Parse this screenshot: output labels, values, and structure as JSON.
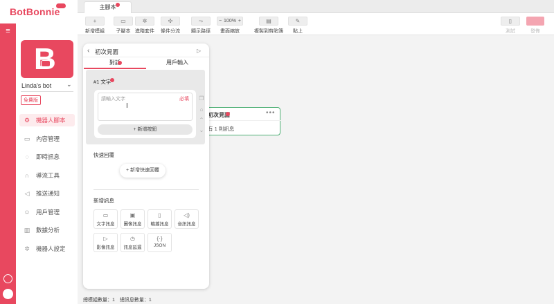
{
  "brand": {
    "name": "BotBonnie",
    "color": "#e8485f"
  },
  "bot": {
    "name": "Linda's bot",
    "plan": "免費版",
    "logo_letter": "B"
  },
  "sidebar": {
    "items": [
      {
        "label": "機器人腳本",
        "icon": "robot-script-icon",
        "active": true
      },
      {
        "label": "內容管理",
        "icon": "folder-icon"
      },
      {
        "label": "即時訊息",
        "icon": "chat-icon"
      },
      {
        "label": "導流工具",
        "icon": "magnet-icon"
      },
      {
        "label": "推送通知",
        "icon": "megaphone-icon"
      },
      {
        "label": "用戶管理",
        "icon": "users-icon"
      },
      {
        "label": "數據分析",
        "icon": "chart-icon"
      },
      {
        "label": "機器人設定",
        "icon": "gear-icon"
      }
    ]
  },
  "tabs": {
    "main": "主腳本"
  },
  "toolbar": {
    "new_module": "新增模組",
    "sub_script": "子腳本",
    "advanced": "進階套件",
    "condition": "條件分流",
    "show_path": "顯示路徑",
    "zoom_value": "100%",
    "zoom_minus": "−",
    "zoom_plus": "+",
    "zoom_label": "畫面縮放",
    "copy": "複製到剪貼簿",
    "paste": "貼上",
    "test": "測試",
    "publish": "發佈"
  },
  "node": {
    "title": "初次見面",
    "subtitle": "有 1 則訊息"
  },
  "panel": {
    "title": "初次見面",
    "tab_dialog": "對話",
    "tab_user_input": "用戶輸入",
    "text_label": "#1 文字",
    "placeholder": "請輸入文字",
    "required": "必填",
    "add_button": "+ 新增按鈕",
    "quick_reply_label": "快速回覆",
    "add_quick_reply": "+ 新增快速回覆",
    "new_message_label": "新增訊息",
    "message_types": [
      {
        "label": "文字訊息",
        "icon": "text-message-icon",
        "glyph": "▭"
      },
      {
        "label": "圖像訊息",
        "icon": "image-message-icon",
        "glyph": "▣"
      },
      {
        "label": "輪播訊息",
        "icon": "carousel-message-icon",
        "glyph": "▯"
      },
      {
        "label": "音訊訊息",
        "icon": "audio-message-icon",
        "glyph": "◁)"
      },
      {
        "label": "影像訊息",
        "icon": "video-message-icon",
        "glyph": "▷"
      },
      {
        "label": "訊息延遲",
        "icon": "clock-icon",
        "glyph": "◷"
      },
      {
        "label": "JSON",
        "icon": "json-icon",
        "glyph": "{·}"
      }
    ]
  },
  "status": {
    "text": "總模組數量：1　總訊息數量：1"
  }
}
